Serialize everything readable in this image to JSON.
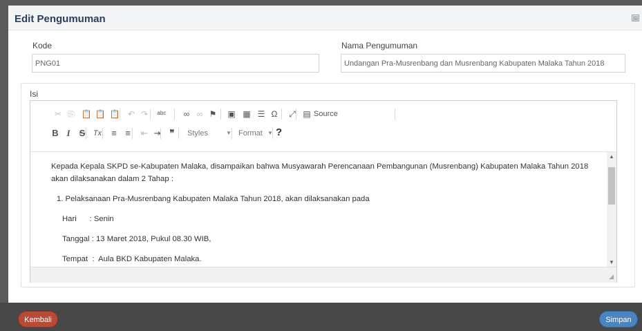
{
  "panel": {
    "title": "Edit Pengumuman"
  },
  "form": {
    "kode_label": "Kode",
    "kode_value": "PNG01",
    "nama_label": "Nama Pengumuman",
    "nama_value": "Undangan Pra-Musrenbang dan Musrenbang Kabupaten Malaka Tahun 2018",
    "isi_label": "Isi"
  },
  "toolbar": {
    "row1": [
      {
        "name": "cut-icon",
        "glyph": "✂",
        "enabled": false
      },
      {
        "name": "copy-icon",
        "glyph": "⎘",
        "enabled": false
      },
      {
        "name": "paste-icon",
        "glyph": "📋",
        "enabled": true
      },
      {
        "name": "paste-text-icon",
        "glyph": "📋",
        "enabled": true
      },
      {
        "name": "paste-word-icon",
        "glyph": "📋",
        "enabled": true
      },
      {
        "name": "undo-icon",
        "glyph": "↶",
        "enabled": false
      },
      {
        "name": "redo-icon",
        "glyph": "↷",
        "enabled": false
      },
      {
        "name": "spellcheck-icon",
        "glyph": "ᵃᵇᶜ",
        "enabled": true
      },
      {
        "name": "link-icon",
        "glyph": "∞",
        "enabled": true
      },
      {
        "name": "unlink-icon",
        "glyph": "∞",
        "enabled": false
      },
      {
        "name": "anchor-icon",
        "glyph": "⚑",
        "enabled": true
      },
      {
        "name": "image-icon",
        "glyph": "▣",
        "enabled": true
      },
      {
        "name": "table-icon",
        "glyph": "▦",
        "enabled": true
      },
      {
        "name": "horizontal-line-icon",
        "glyph": "☰",
        "enabled": true
      },
      {
        "name": "special-char-icon",
        "glyph": "Ω",
        "enabled": true
      },
      {
        "name": "maximize-icon",
        "glyph": "⤢",
        "enabled": true
      },
      {
        "name": "source-icon",
        "glyph": "▤",
        "enabled": true
      }
    ],
    "source_label": "Source",
    "row2": [
      {
        "name": "bold-icon",
        "glyph": "B",
        "enabled": true
      },
      {
        "name": "italic-icon",
        "glyph": "I",
        "enabled": true
      },
      {
        "name": "strikethrough-icon",
        "glyph": "S",
        "enabled": true
      },
      {
        "name": "remove-format-icon",
        "glyph": "Tx",
        "enabled": true
      },
      {
        "name": "numbered-list-icon",
        "glyph": "≡",
        "enabled": true
      },
      {
        "name": "bulleted-list-icon",
        "glyph": "≡",
        "enabled": true
      },
      {
        "name": "outdent-icon",
        "glyph": "⇤",
        "enabled": false
      },
      {
        "name": "indent-icon",
        "glyph": "⇥",
        "enabled": true
      },
      {
        "name": "blockquote-icon",
        "glyph": "❞",
        "enabled": true
      }
    ],
    "styles_label": "Styles",
    "format_label": "Format",
    "help_glyph": "?"
  },
  "content": {
    "para1": "Kepada Kepala SKPD se-Kabupaten Malaka, disampaikan bahwa Musyawarah Perencanaan Pembangunan (Musrenbang) Kabupaten Malaka Tahun 2018 akan dilaksanakan dalam 2 Tahap :",
    "item1": "1. Pelaksanaan Pra-Musrenbang Kabupaten Malaka Tahun 2018, akan dilaksanakan pada",
    "hari": "Hari      : Senin",
    "tanggal": "Tanggal : 13 Maret 2018, Pukul 08.30 WIB,",
    "tempat": "Tempat  :  Aula BKD Kabupaten Malaka."
  },
  "footer": {
    "back_label": "Kembali",
    "save_label": "Simpan"
  }
}
